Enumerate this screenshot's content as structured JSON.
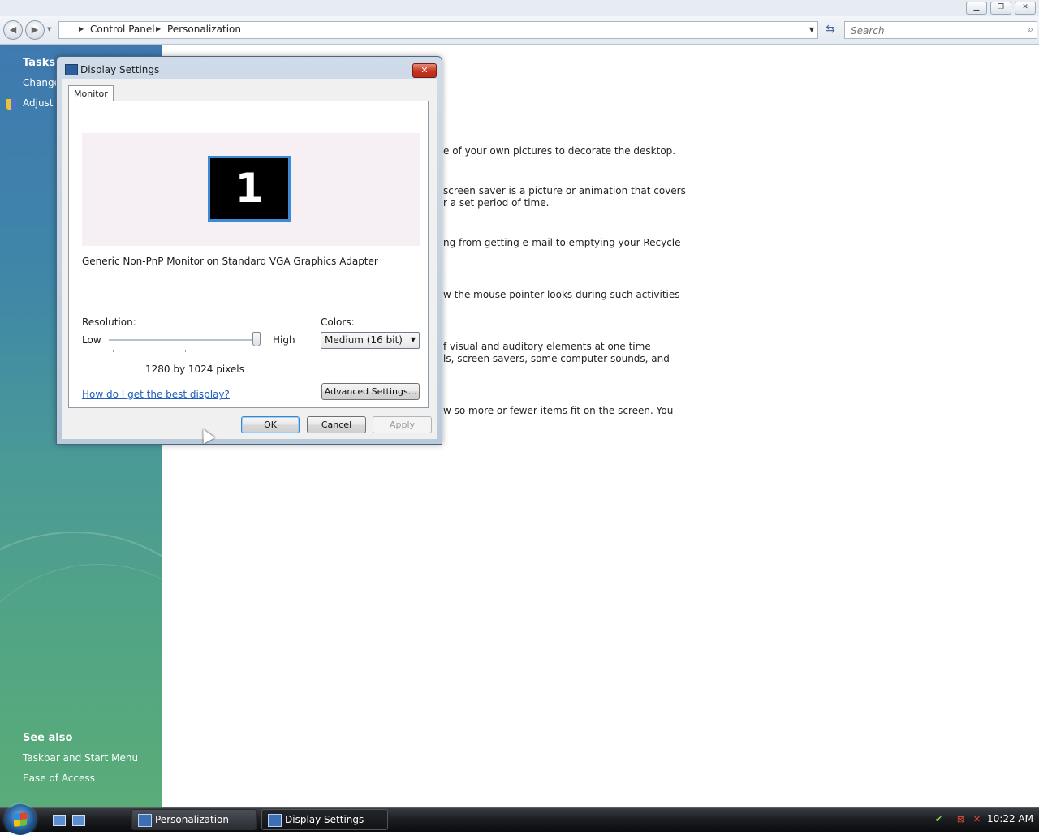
{
  "address": {
    "crumbs": [
      "Control Panel",
      "Personalization"
    ],
    "search_placeholder": "Search"
  },
  "left_pane": {
    "tasks_heading": "Tasks",
    "task_links": [
      "Change",
      "Adjust f"
    ],
    "see_also_heading": "See also",
    "see_also_links": [
      "Taskbar and Start Menu",
      "Ease of Access"
    ]
  },
  "background_text": [
    "e of your own pictures to decorate the desktop.",
    "screen saver is a picture or animation that covers",
    "r a set period of time.",
    "ng from getting e-mail to emptying your Recycle",
    "w the mouse pointer looks during such activities",
    "f visual and auditory elements at one time",
    "ls, screen savers, some computer sounds, and",
    "w so more or fewer items fit on the screen. You"
  ],
  "dialog": {
    "title": "Display Settings",
    "close_glyph": "✕",
    "tab": "Monitor",
    "monitor_number": "1",
    "monitor_description": "Generic Non-PnP Monitor on Standard VGA Graphics Adapter",
    "resolution_label": "Resolution:",
    "low_label": "Low",
    "high_label": "High",
    "resolution_value": "1280 by 1024 pixels",
    "resolution_slider_fraction": 1.0,
    "colors_label": "Colors:",
    "colors_value": "Medium (16 bit)",
    "advanced_button": "Advanced Settings...",
    "help_link": "How do I get the best display?",
    "ok_button": "OK",
    "cancel_button": "Cancel",
    "apply_button": "Apply"
  },
  "taskbar": {
    "buttons": [
      "Personalization",
      "Display Settings"
    ],
    "clock": "10:22 AM"
  },
  "icons": {
    "back": "back-arrow-icon",
    "forward": "forward-arrow-icon",
    "search": "magnifier-icon",
    "shield": "uac-shield-icon"
  }
}
